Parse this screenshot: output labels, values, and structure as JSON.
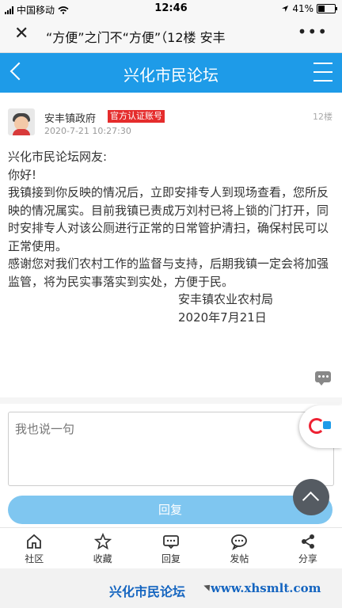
{
  "status_bar": {
    "carrier": "中国移动",
    "time": "12:46",
    "battery": "41%",
    "battery_level": 0.41
  },
  "browser": {
    "title": "“方便”之门不“方便”（12楼 安丰"
  },
  "app_bar": {
    "title": "兴化市民论坛"
  },
  "post": {
    "author": "安丰镇政府",
    "badge": "官方认证账号",
    "date": "2020-7-21 10:27:30",
    "floor": "12楼",
    "paragraphs": [
      "兴化市民论坛网友:",
      "你好!",
      "我镇接到你反映的情况后，立即安排专人到现场查看，您所反映的情况属实。目前我镇已责成万刘村已将上锁的门打开，同时安排专人对该公厕进行正常的日常管护清扫，确保村民可以正常使用。",
      "感谢您对我们农村工作的监督与支持，后期我镇一定会将加强监管，将为民实事落实到实处，方便于民。"
    ],
    "signature_org": "安丰镇农业农村局",
    "signature_date": "2020年7月21日"
  },
  "reply": {
    "placeholder": "我也说一句",
    "button": "回复"
  },
  "tabs": [
    {
      "label": "社区",
      "icon": "home-icon"
    },
    {
      "label": "收藏",
      "icon": "star-icon"
    },
    {
      "label": "回复",
      "icon": "message-icon"
    },
    {
      "label": "发帖",
      "icon": "chat-bubble-icon"
    },
    {
      "label": "分享",
      "icon": "share-icon"
    }
  ],
  "footer": {
    "site": "兴化市民论坛",
    "url": "www.xhsmlt.com"
  },
  "colors": {
    "accent": "#1e9be8",
    "badge": "#e52c2c",
    "reply_button": "#7fc6f0"
  }
}
